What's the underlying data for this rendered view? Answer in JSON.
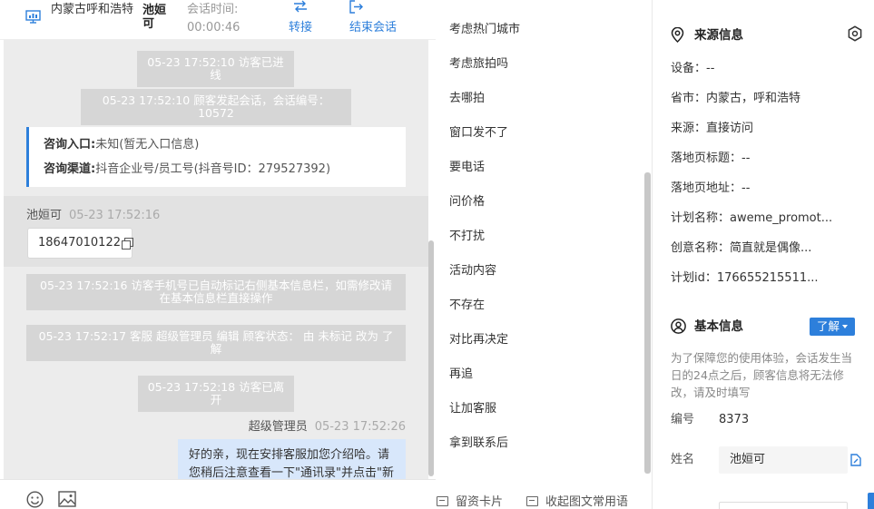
{
  "header": {
    "location": "内蒙古呼和浩特",
    "visitor_name": "池姮可",
    "time_label": "会话时间:",
    "time_value": "00:00:46",
    "transfer_label": "转接",
    "end_label": "结束会话"
  },
  "chat": {
    "messages": [
      {
        "type": "system",
        "text": "05-23 17:52:10 访客已进线"
      },
      {
        "type": "system",
        "text": "05-23 17:52:10 顾客发起会话，会话编号：10572"
      },
      {
        "type": "system",
        "text": "05-23 17:52:16 访客手机号已自动标记右侧基本信息栏，如需修改请在基本信息栏直接操作"
      },
      {
        "type": "system",
        "text": "05-23 17:52:17 客服 超级管理员 编辑 顾客状态： 由 未标记 改为 了解"
      },
      {
        "type": "system",
        "text": "05-23 17:52:18 访客已离开"
      }
    ],
    "info_card": {
      "entry_label": "咨询入口:",
      "entry_value": "未知(暂无入口信息)",
      "channel_label": "咨询渠道:",
      "channel_value": "抖音企业号/员工号(抖音号ID：279527392)"
    },
    "visitor_message": {
      "sender": "池姮可",
      "timestamp": "05-23 17:52:16",
      "text": "18647010122"
    },
    "agent_message": {
      "sender": "超级管理员",
      "timestamp": "05-23 17:52:26",
      "text": "好的亲，现在安排客服加您介绍哈。请您稍后注意查看一下\"通讯录\"并点击\"新"
    }
  },
  "input_bar": {
    "emoji_icon": "smile-icon",
    "image_icon": "image-icon"
  },
  "quick_replies": {
    "items": [
      "考虑热门城市",
      "考虑旅拍吗",
      "去哪拍",
      "窗口发不了",
      "要电话",
      "问价格",
      "不打扰",
      "活动内容",
      "不存在",
      "对比再决定",
      "再追",
      "让加客服",
      "拿到联系后"
    ],
    "card_button": "留资卡片",
    "collapse_button": "收起图文常用语"
  },
  "source_info": {
    "title": "来源信息",
    "fields": [
      "设备：--",
      "省市：内蒙古，呼和浩特",
      "来源：直接访问",
      "落地页标题：--",
      "落地页地址：--",
      "计划名称：aweme_promot...",
      "创意名称：简直就是偶像...",
      "计划id：176655215511..."
    ]
  },
  "basic_info": {
    "title": "基本信息",
    "status_button": "了解",
    "notice": "为了保障您的使用体验，会话发生当日的24点之后，顾客信息将无法修改，请及时填写",
    "id_label": "编号",
    "id_value": "8373",
    "name_label": "姓名",
    "name_value": "池姮可"
  },
  "colors": {
    "accent": "#2d7fdb",
    "chat_bg": "#ececec",
    "system_msg_bg": "#d6d6d6",
    "agent_bubble_bg": "#d8e7fb"
  }
}
